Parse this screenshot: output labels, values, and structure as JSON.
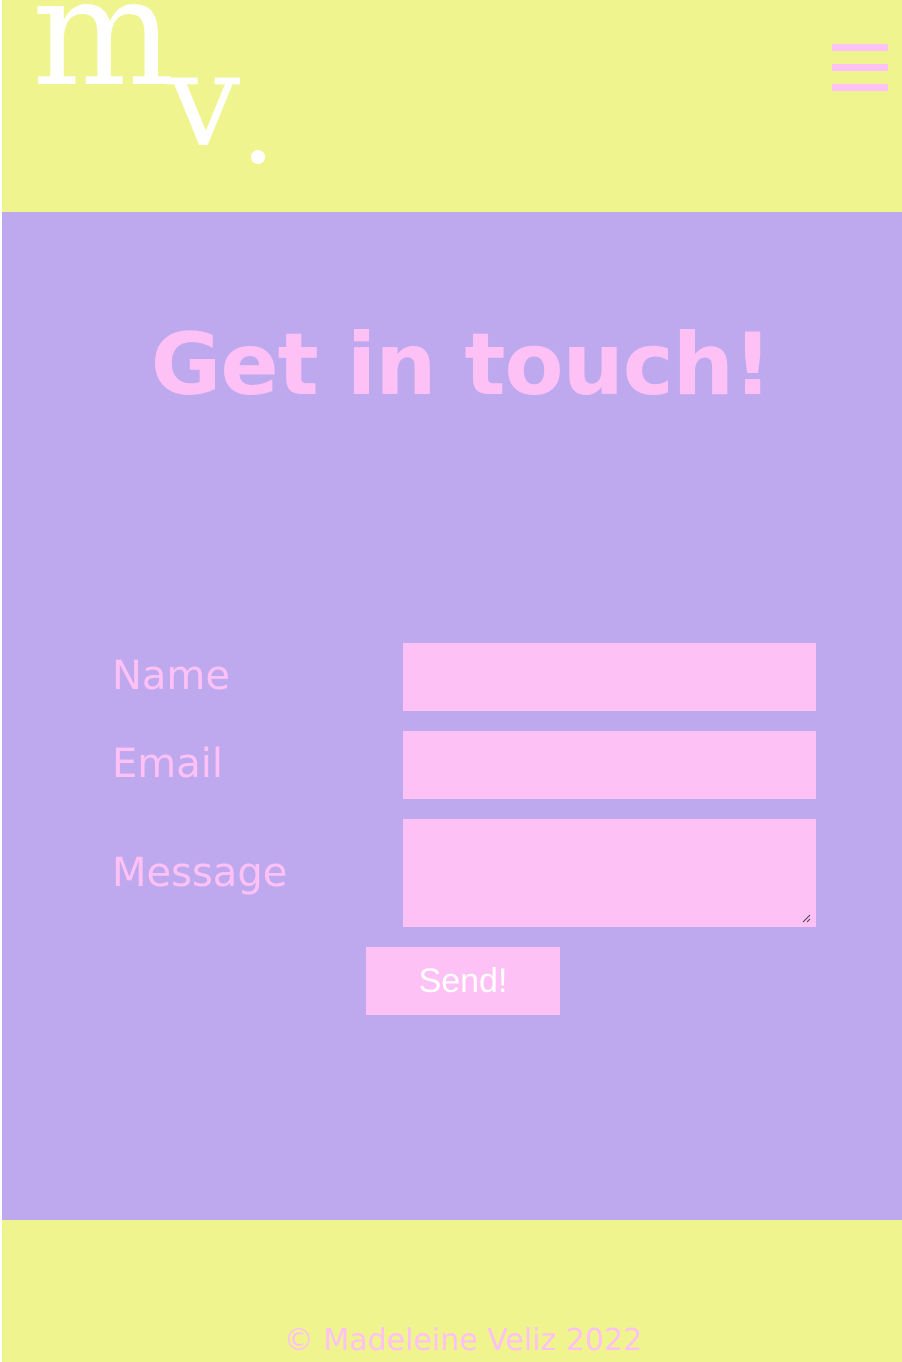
{
  "header": {
    "logo_letters": "mv.",
    "logo_m": "m",
    "logo_v": "v",
    "menu_icon": "hamburger-menu-icon"
  },
  "main": {
    "title": "Get in touch!",
    "form": {
      "name_label": "Name",
      "name_value": "",
      "email_label": "Email",
      "email_value": "",
      "message_label": "Message",
      "message_value": "",
      "send_label": "Send!"
    }
  },
  "footer": {
    "copyright": "© Madeleine Veliz 2022"
  },
  "colors": {
    "header_bg": "#eff48f",
    "main_bg": "#bea9ef",
    "accent_pink": "#fdc1f5",
    "logo_white": "#ffffff"
  }
}
